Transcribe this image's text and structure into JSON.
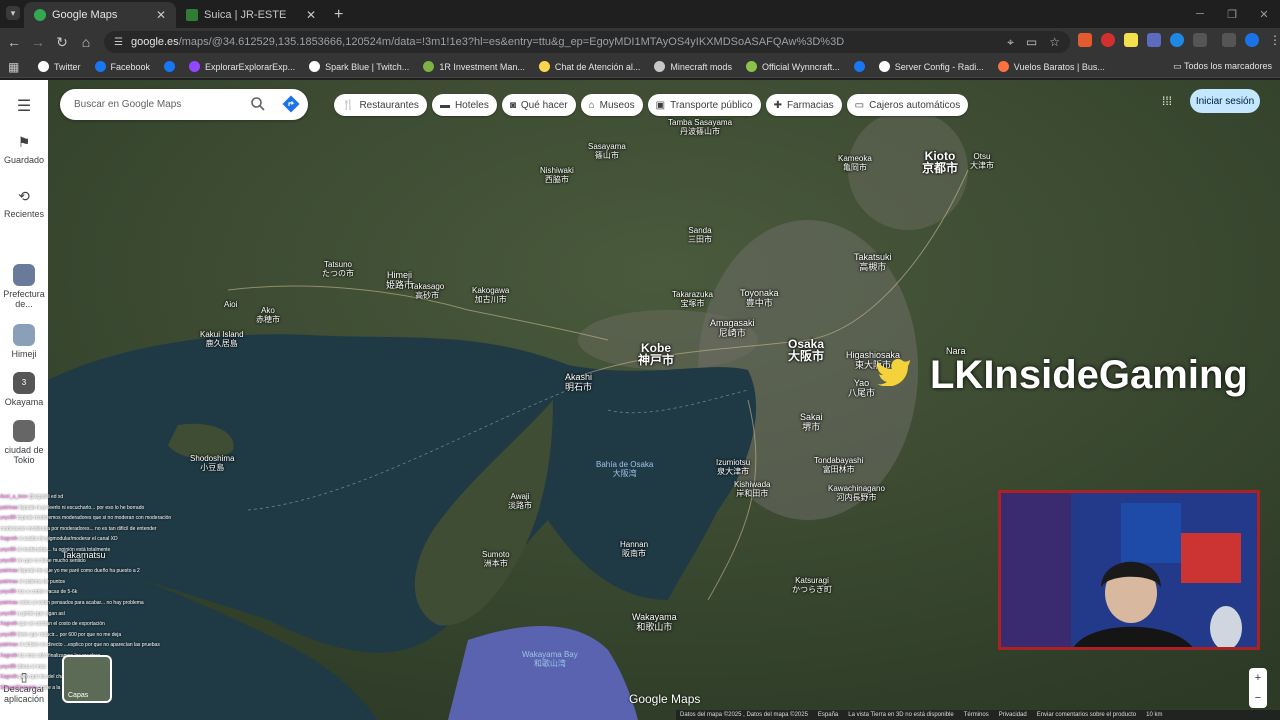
{
  "browser": {
    "tabs": [
      {
        "label": "Google Maps",
        "active": true
      },
      {
        "label": "Suica | JR-ESTE",
        "active": false
      }
    ],
    "url_host": "google.es",
    "url_path": "/maps/@34.612529,135.1853666,120524m/data=!3m1!1e3?hl=es&entry=ttu&g_ep=EgoyMDI1MTAyOS4yIKXMDSoASAFQAw%3D%3D",
    "bookmarks": [
      {
        "label": "Twitter",
        "icon": "x-icon",
        "color": "#ffffff"
      },
      {
        "label": "Facebook",
        "icon": "facebook-icon",
        "color": "#1877f2"
      },
      {
        "label": "",
        "icon": "facebook-icon",
        "color": "#1877f2"
      },
      {
        "label": "ExplorarExplorarExp...",
        "icon": "twitch-icon",
        "color": "#9146ff"
      },
      {
        "label": "Spark Blue | Twitch...",
        "icon": "spark-icon",
        "color": "#ffffff"
      },
      {
        "label": "1R Investment Man...",
        "icon": "investment-icon",
        "color": "#7cb342"
      },
      {
        "label": "Chat de Atención al...",
        "icon": "chat-icon",
        "color": "#ffd54f"
      },
      {
        "label": "Minecraft mods",
        "icon": "folder-icon",
        "color": "#c7c7c7"
      },
      {
        "label": "Official Wynncraft...",
        "icon": "wynncraft-icon",
        "color": "#8bc34a"
      },
      {
        "label": "",
        "icon": "facebook-icon",
        "color": "#1877f2"
      },
      {
        "label": "Server Config - Radi...",
        "icon": "server-icon",
        "color": "#ffffff"
      },
      {
        "label": "Vuelos Baratos | Bus...",
        "icon": "flight-icon",
        "color": "#ff7043"
      }
    ],
    "all_bookmarks": "Todos los marcadores"
  },
  "maps": {
    "search_placeholder": "Buscar en Google Maps",
    "chips": [
      {
        "label": "Restaurantes",
        "icon": "fork-knife-icon"
      },
      {
        "label": "Hoteles",
        "icon": "bed-icon"
      },
      {
        "label": "Qué hacer",
        "icon": "camera-icon"
      },
      {
        "label": "Museos",
        "icon": "museum-icon"
      },
      {
        "label": "Transporte público",
        "icon": "train-icon"
      },
      {
        "label": "Farmacias",
        "icon": "pharmacy-icon"
      },
      {
        "label": "Cajeros automáticos",
        "icon": "atm-icon"
      }
    ],
    "signin": "Iniciar sesión",
    "rail": {
      "saved": "Guardado",
      "recent": "Recientes",
      "recents": [
        {
          "label": "Prefectura de...",
          "color": "#6a7a9a"
        },
        {
          "label": "Himeji",
          "color": "#8aa0b8"
        },
        {
          "label": "Okayama",
          "color": "#555555",
          "badge": "3"
        },
        {
          "label": "ciudad de Tokio",
          "color": "#666666"
        }
      ],
      "app": "Descargar aplicación"
    },
    "layers_label": "Capas",
    "logo": "Google Maps",
    "footer": [
      "Datos del mapa ©2025 , Datos del mapa ©2025",
      "España",
      "La vista Tierra en 3D no está disponible",
      "Términos",
      "Privacidad",
      "Enviar comentarios sobre el producto",
      "10 km"
    ],
    "places": [
      {
        "name": "Kioto",
        "jp": "京都市",
        "size": "big"
      },
      {
        "name": "Osaka",
        "jp": "大阪市",
        "size": "big"
      },
      {
        "name": "Kobe",
        "jp": "神戸市",
        "size": "big"
      },
      {
        "name": "Himeji",
        "jp": "姫路市",
        "size": "mid"
      },
      {
        "name": "Akashi",
        "jp": "明石市",
        "size": "mid"
      },
      {
        "name": "Sakai",
        "jp": "堺市",
        "size": "mid"
      },
      {
        "name": "Amagasaki",
        "jp": "尼崎市",
        "size": "mid"
      },
      {
        "name": "Toyonaka",
        "jp": "豊中市",
        "size": "mid"
      },
      {
        "name": "Takatsuki",
        "jp": "高槻市",
        "size": "mid"
      },
      {
        "name": "Higashiosaka",
        "jp": "東大阪市",
        "size": "mid"
      },
      {
        "name": "Yao",
        "jp": "八尾市",
        "size": "mid"
      },
      {
        "name": "Nara",
        "jp": "",
        "size": "mid"
      },
      {
        "name": "Wakayama",
        "jp": "和歌山市",
        "size": "mid"
      },
      {
        "name": "Takamatsu",
        "jp": "",
        "size": "mid"
      },
      {
        "name": "Otsu",
        "jp": "大津市",
        "size": "small"
      },
      {
        "name": "Kameoka",
        "jp": "亀岡市",
        "size": "small"
      },
      {
        "name": "Sanda",
        "jp": "三田市",
        "size": "small"
      },
      {
        "name": "Nishiwaki",
        "jp": "西脇市",
        "size": "small"
      },
      {
        "name": "Kakogawa",
        "jp": "加古川市",
        "size": "small"
      },
      {
        "name": "Takasago",
        "jp": "高砂市",
        "size": "small"
      },
      {
        "name": "Takarazuka",
        "jp": "宝塚市",
        "size": "small"
      },
      {
        "name": "Izumiotsu",
        "jp": "泉大津市",
        "size": "small"
      },
      {
        "name": "Kishiwada",
        "jp": "岸和田市",
        "size": "small"
      },
      {
        "name": "Hannan",
        "jp": "阪南市",
        "size": "small"
      },
      {
        "name": "Sumoto",
        "jp": "洲本市",
        "size": "small"
      },
      {
        "name": "Awaji",
        "jp": "淡路市",
        "size": "small"
      },
      {
        "name": "Kakui Island",
        "jp": "鹿久居島",
        "size": "small"
      },
      {
        "name": "Shodoshima",
        "jp": "小豆島",
        "size": "small"
      },
      {
        "name": "Tondabayashi",
        "jp": "富田林市",
        "size": "small"
      },
      {
        "name": "Kawachinagano",
        "jp": "河内長野市",
        "size": "small"
      },
      {
        "name": "Katsuragi",
        "jp": "かつらぎ町",
        "size": "small"
      },
      {
        "name": "Ako",
        "jp": "赤穂市",
        "size": "small"
      },
      {
        "name": "Aioi",
        "jp": "",
        "size": "small"
      },
      {
        "name": "Tatsuno",
        "jp": "たつの市",
        "size": "small"
      },
      {
        "name": "Sasayama",
        "jp": "篠山市",
        "size": "small"
      },
      {
        "name": "Tamba Sasayama",
        "jp": "丹波篠山市",
        "size": "small"
      }
    ],
    "water": [
      {
        "name": "Bahía de Osaka",
        "jp": "大阪湾"
      },
      {
        "name": "Wakayama Bay",
        "jp": "和歌山湾"
      }
    ]
  },
  "overlay": {
    "streamer_name": "LKInsideGaming",
    "chat": [
      {
        "user": "Axel_a_leon",
        "msg": "@xigoteli ed xd"
      },
      {
        "user": "patrinas",
        "msg": "lispeak ni yo leerlo ni escucharlo... por eso lo he borrado"
      },
      {
        "user": "yoyc89",
        "msg": "lispeak moderemos moderadores que si no moderan con moderación"
      },
      {
        "user": "",
        "msg": "moderacion moderada por moderadores... no es tan difícil de entender"
      },
      {
        "user": "Xagroth",
        "msg": "si acaba de gigmodular/moderar el canal XD"
      },
      {
        "user": "yoyc89",
        "msg": "al moderarlas... tu opinión está totalmente"
      },
      {
        "user": "yoyc89",
        "msg": "en que no tiene mucho sentido"
      },
      {
        "user": "patrinas",
        "msg": "lispeak me que yo me paré como dueño ha puesto a 2"
      },
      {
        "user": "patrinas",
        "msg": "el sistema de puntos"
      },
      {
        "user": "yoyc89",
        "msg": "nos a comer vacas de 5-6k"
      },
      {
        "user": "patrinas",
        "msg": "estos sí estan pensados para acabar... no hay problema"
      },
      {
        "user": "yoyc89",
        "msg": "a gente que sigan así"
      },
      {
        "user": "Xagroth",
        "msg": "que se centran el costo de exportación"
      },
      {
        "user": "yoyc89",
        "msg": "tiene que reducir... por 600 por que no me deja"
      },
      {
        "user": "patrinas",
        "msg": "el al bien en directo ...explico por que no aparecían las pruebas"
      },
      {
        "user": "Xagroth",
        "msg": "los mas sólo finalizamos las pruebas"
      },
      {
        "user": "yoyc89",
        "msg": "ahora sí mas"
      },
      {
        "user": "Xagroth",
        "msg": "pero que los del chat ya nos hemos ido"
      },
      {
        "user": "StreamElements",
        "msg": "únete a la comunidad de discord"
      }
    ]
  },
  "colors": {
    "chrome_bg": "#1f1f1f",
    "toolbar_bg": "#353535",
    "accent": "#c2e7ff",
    "cam_frame": "#aa2222"
  }
}
